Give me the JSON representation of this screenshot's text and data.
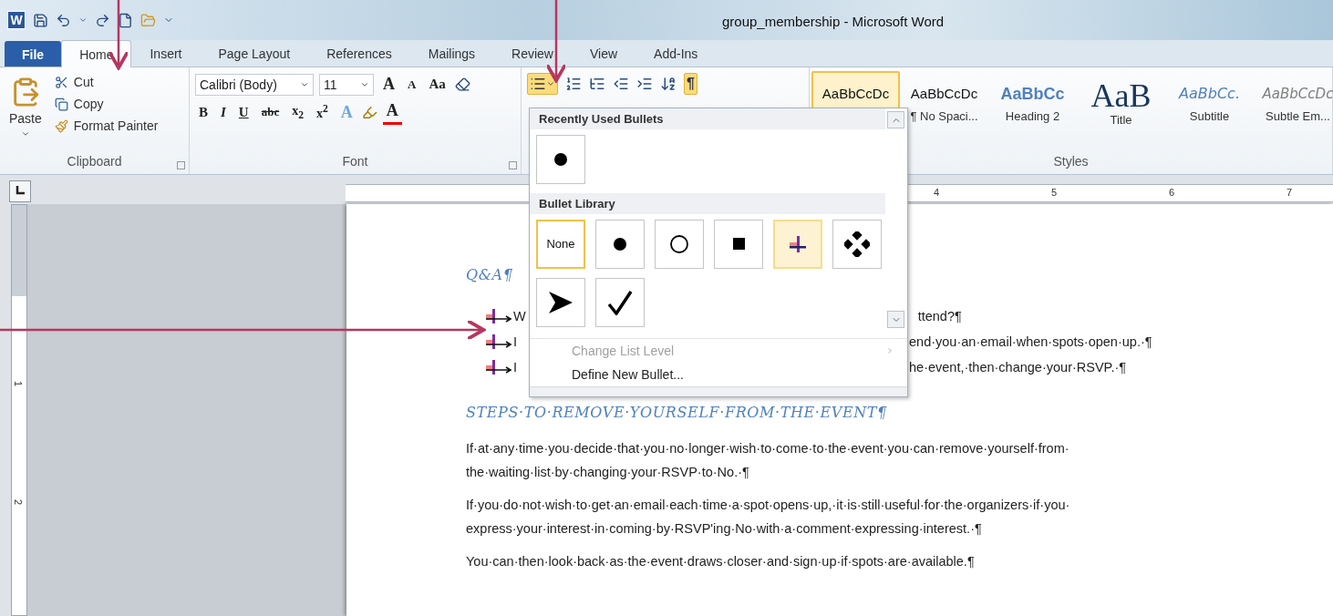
{
  "window": {
    "app_icon": "W",
    "title": "group_membership  -  Microsoft Word"
  },
  "tabs": [
    {
      "label": "File",
      "kind": "file",
      "selected": false
    },
    {
      "label": "Home",
      "kind": "tab",
      "selected": true
    },
    {
      "label": "Insert",
      "kind": "tab",
      "selected": false
    },
    {
      "label": "Page Layout",
      "kind": "tab",
      "selected": false
    },
    {
      "label": "References",
      "kind": "tab",
      "selected": false
    },
    {
      "label": "Mailings",
      "kind": "tab",
      "selected": false
    },
    {
      "label": "Review",
      "kind": "tab",
      "selected": false
    },
    {
      "label": "View",
      "kind": "tab",
      "selected": false
    },
    {
      "label": "Add-Ins",
      "kind": "tab",
      "selected": false
    }
  ],
  "clipboard": {
    "paste": "Paste",
    "cut": "Cut",
    "copy": "Copy",
    "format_painter": "Format Painter",
    "group_label": "Clipboard"
  },
  "font": {
    "font_name": "Calibri (Body)",
    "font_size": "11",
    "grow": "A",
    "shrink": "A",
    "change_case": "Aa",
    "bold": "B",
    "italic": "I",
    "underline": "U",
    "strikethrough": "abc",
    "subscript": "x$_{2}$",
    "superscript": "x$^{2}$",
    "effects": "A",
    "font_color": "A",
    "group_label": "Font"
  },
  "paragraph": {
    "bullets_active": true,
    "show_marks": "¶",
    "show_marks_active": true
  },
  "styles": {
    "items": [
      {
        "preview": "AaBbCcDc",
        "kind": "normal",
        "selected": true
      },
      {
        "preview": "AaBbCcDc",
        "label": "¶ No Spaci...",
        "kind": "normal",
        "selected": false
      },
      {
        "preview": "AaBbCc",
        "label": "Heading 2",
        "kind": "heading",
        "selected": false
      },
      {
        "preview": "AaB",
        "label": "Title",
        "kind": "title",
        "selected": false
      },
      {
        "preview": "AaBbCc.",
        "label": "Subtitle",
        "kind": "subtitle",
        "selected": false
      },
      {
        "preview": "AaBbCcDc",
        "label": "Subtle Em...",
        "kind": "subtle",
        "selected": false
      }
    ],
    "group_label": "Styles"
  },
  "ruler": {
    "labels": [
      "4",
      "5",
      "6",
      "7"
    ]
  },
  "vertical_ruler": {
    "labels": [
      "1",
      "2"
    ]
  },
  "document": {
    "heading_1": "Q&A¶",
    "bullets": [
      {
        "lead": "W",
        "tail": "ttend?¶"
      },
      {
        "lead": "I",
        "tail": "end·you·an·email·when·spots·open·up.·¶"
      },
      {
        "lead": "I",
        "tail": "he·event,·then·change·your·RSVP.·¶"
      }
    ],
    "heading_2": "STEPS·TO·REMOVE·YOURSELF·FROM·THE·EVENT¶",
    "paragraphs": [
      {
        "lines": [
          "If·at·any·time·you·decide·that·you·no·longer·wish·to·come·to·the·event·you·can·remove·yourself·from·",
          "the·waiting·list·by·changing·your·RSVP·to·No.·¶"
        ]
      },
      {
        "lines": [
          "If·you·do·not·wish·to·get·an·email·each·time·a·spot·opens·up,·it·is·still·useful·for·the·organizers·if·you·",
          "express·your·interest·in·coming·by·RSVP'ing·No·with·a·comment·expressing·interest.·¶"
        ]
      },
      {
        "lines": [
          "You·can·then·look·back·as·the·event·draws·closer·and·sign·up·if·spots·are·available.¶"
        ]
      }
    ]
  },
  "bullet_menu": {
    "recent_header": "Recently Used Bullets",
    "recent": [
      {
        "kind": "dot",
        "selected": false
      }
    ],
    "library_header": "Bullet Library",
    "library": [
      {
        "kind": "none",
        "label": "None",
        "hovered": true,
        "selected": false
      },
      {
        "kind": "dot",
        "hovered": false,
        "selected": false
      },
      {
        "kind": "circle",
        "hovered": false,
        "selected": false
      },
      {
        "kind": "square",
        "hovered": false,
        "selected": false
      },
      {
        "kind": "cross",
        "hovered": false,
        "selected": true
      },
      {
        "kind": "diamonds",
        "hovered": false,
        "selected": false
      },
      {
        "kind": "arrow",
        "hovered": false,
        "selected": false
      },
      {
        "kind": "check",
        "hovered": false,
        "selected": false
      }
    ],
    "commands": [
      {
        "label": "Change List Level",
        "disabled": true,
        "submenu": true
      },
      {
        "label": "Define New Bullet...",
        "disabled": false,
        "submenu": false
      }
    ]
  }
}
